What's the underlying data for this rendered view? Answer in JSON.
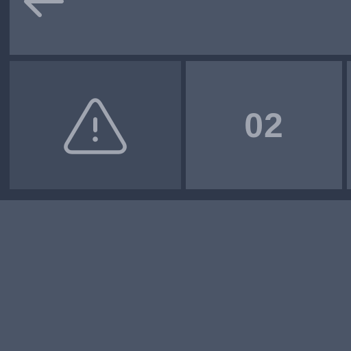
{
  "header": {
    "back_icon": "arrow-left-icon"
  },
  "tiles": [
    {
      "icon": "warning-triangle-icon",
      "label": ""
    },
    {
      "label": "02"
    }
  ],
  "colors": {
    "background": "#4b5567",
    "frame": "#2f384a",
    "tile_selected": "#404a5c",
    "icon": "#a0a5b0"
  }
}
